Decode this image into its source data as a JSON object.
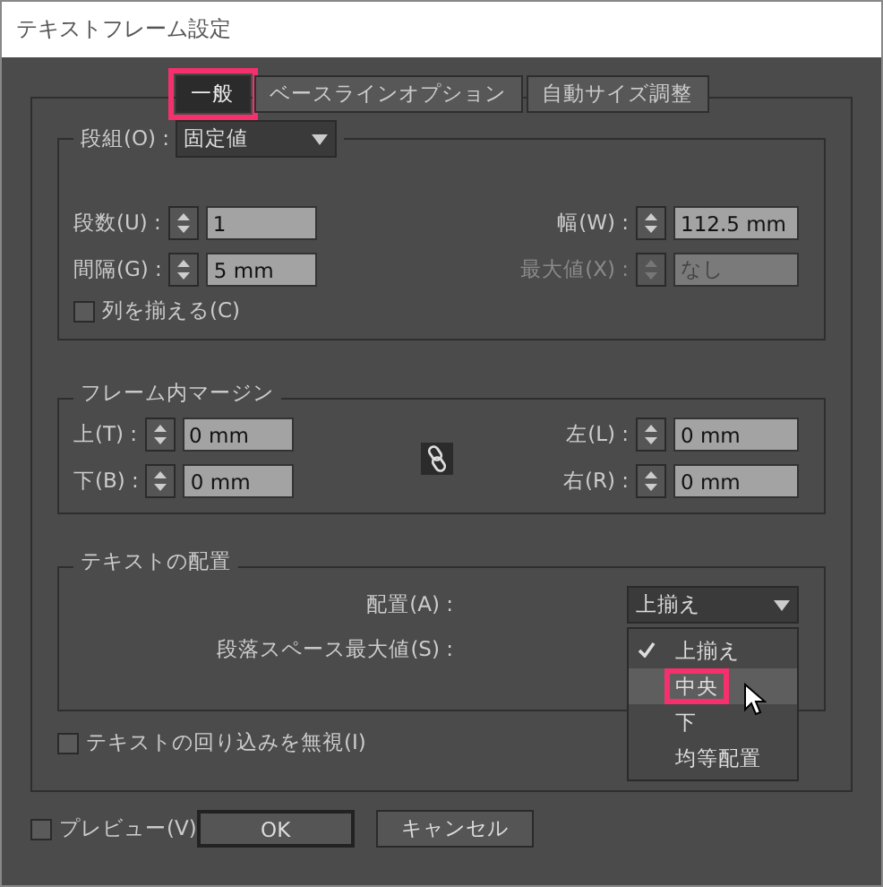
{
  "window": {
    "title": "テキストフレーム設定"
  },
  "tabs": [
    {
      "label": "一般",
      "selected": true,
      "annotated": true
    },
    {
      "label": "ベースラインオプション",
      "selected": false,
      "annotated": false
    },
    {
      "label": "自動サイズ調整",
      "selected": false,
      "annotated": false
    }
  ],
  "columns": {
    "label": "段組(O) :",
    "mode": "固定値",
    "fields": [
      {
        "label": "段数(U) :",
        "value": "1",
        "disabled": false
      },
      {
        "label": "幅(W) :",
        "value": "112.5 mm",
        "disabled": false
      },
      {
        "label": "間隔(G) :",
        "value": "5 mm",
        "disabled": false
      },
      {
        "label": "最大値(X) :",
        "value": "なし",
        "disabled": true
      }
    ],
    "balance": {
      "label": "列を揃える(C)",
      "checked": false
    }
  },
  "inset": {
    "title": "フレーム内マージン",
    "fields": [
      {
        "label": "上(T) :",
        "value": "0 mm"
      },
      {
        "label": "左(L) :",
        "value": "0 mm"
      },
      {
        "label": "下(B) :",
        "value": "0 mm"
      },
      {
        "label": "右(R) :",
        "value": "0 mm"
      }
    ]
  },
  "align": {
    "title": "テキストの配置",
    "align_label": "配置(A) :",
    "align_value": "上揃え",
    "spacing_label": "段落スペース最大値(S) :",
    "menu": [
      {
        "label": "上揃え",
        "checked": true,
        "hovered": false,
        "annotated": false
      },
      {
        "label": "中央",
        "checked": false,
        "hovered": true,
        "annotated": true
      },
      {
        "label": "下",
        "checked": false,
        "hovered": false,
        "annotated": false
      },
      {
        "label": "均等配置",
        "checked": false,
        "hovered": false,
        "annotated": false
      }
    ]
  },
  "ignore_wrap": {
    "label": "テキストの回り込みを無視(I)",
    "checked": false
  },
  "preview": {
    "label": "プレビュー(V)",
    "checked": false
  },
  "buttons": [
    {
      "label": "OK",
      "kind": "default"
    },
    {
      "label": "キャンセル",
      "kind": "normal"
    }
  ]
}
